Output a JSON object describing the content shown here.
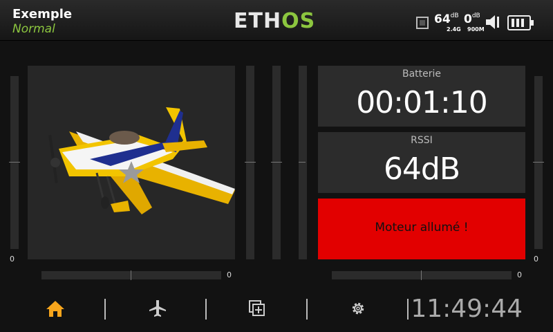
{
  "header": {
    "model_name": "Exemple",
    "flight_mode": "Normal",
    "logo_main": "ETH",
    "logo_accent": "OS",
    "rssi_24": "64",
    "rssi_24_unit": "dB",
    "rssi_900": "0",
    "rssi_900_unit": "dB",
    "band_24": "2.4G",
    "band_900": "900M"
  },
  "sliders": {
    "left_vertical_value": "0",
    "left_horizontal_value": "0",
    "right_horizontal_value": "0",
    "right_vertical_value": "0"
  },
  "widgets": {
    "timer_title": "Batterie",
    "timer_value": "00:01:10",
    "rssi_title": "RSSI",
    "rssi_value": "64dB",
    "alarm_text": "Moteur allumé !"
  },
  "footer": {
    "clock": "11:49:44",
    "nav": [
      "home-icon",
      "airplane-icon",
      "widgets-icon",
      "gear-icon"
    ],
    "active_color": "#f7a51c"
  },
  "colors": {
    "accent_green": "#8cc63f",
    "alarm_red": "#e20000"
  }
}
